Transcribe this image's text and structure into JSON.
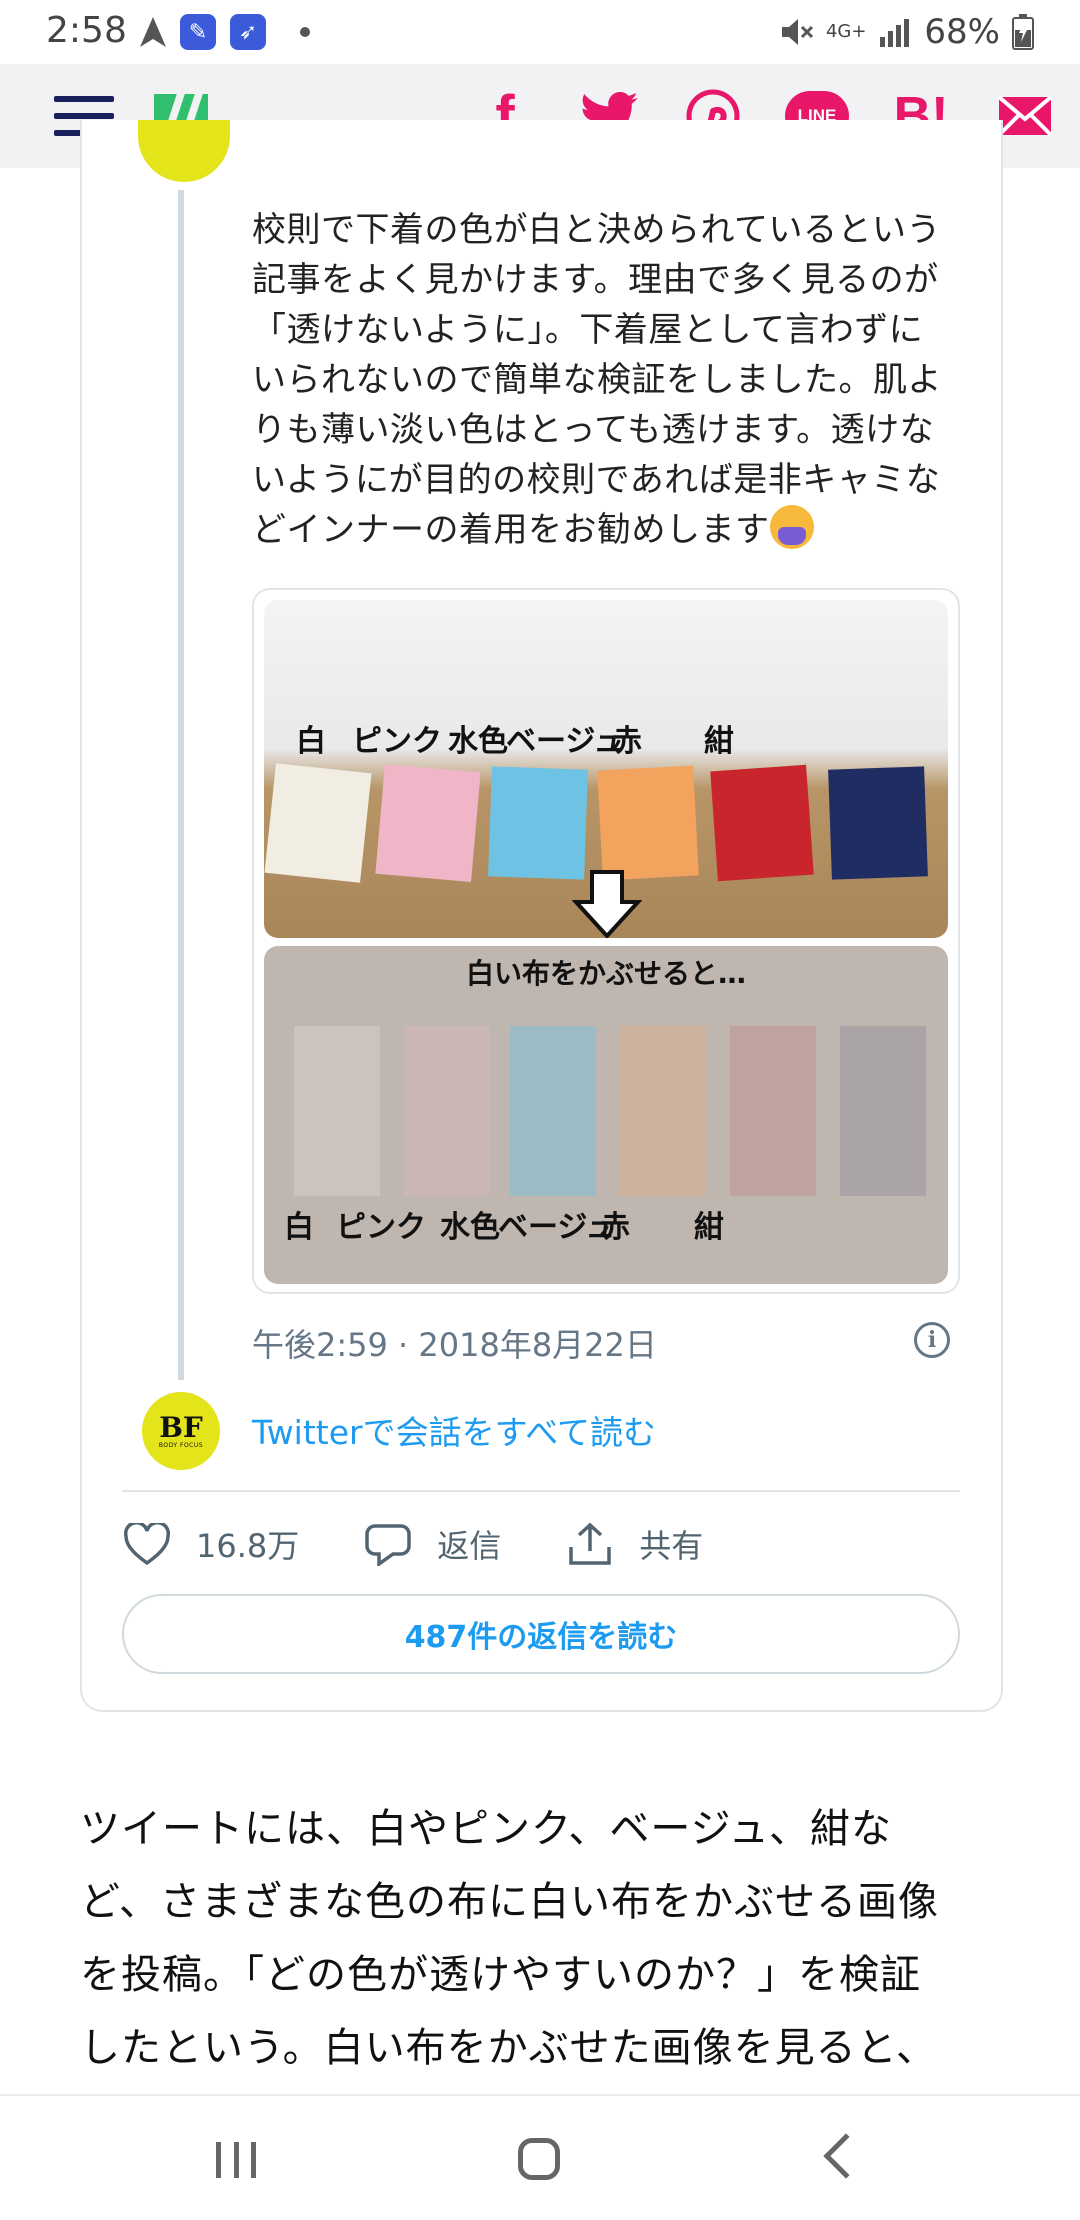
{
  "status_bar": {
    "time": "2:58",
    "network": "4G+",
    "battery": "68%"
  },
  "share_bar": {
    "icons": [
      "menu-icon",
      "site-logo",
      "facebook-icon",
      "twitter-icon",
      "pinterest-icon",
      "line-icon",
      "hatena-bookmark-icon",
      "mail-icon"
    ],
    "facebook_glyph": "f",
    "line_label": "LINE",
    "hatena_label": "B!",
    "accent_color": "#e8176a",
    "logo_color": "#2fbf6e"
  },
  "tweet": {
    "text": "校則で下着の色が白と決められているという\n記事をよく見かけます。理由で多く見るのが\n「透けないように」。下着屋として言わずに\nいられないので簡単な検証をしました。肌よ\nりも薄い淡い色はとっても透けます。透けな\nいようにが目的の校則であれば是非キャミな\nどインナーの着用をお勧めします",
    "photo": {
      "top_labels": [
        "白",
        "ピンク",
        "水色",
        "ベージュ",
        "赤",
        "紺"
      ],
      "caption": "白い布をかぶせると…",
      "bottom_labels": [
        "白",
        "ピンク",
        "水色",
        "ベージュ",
        "赤",
        "紺"
      ],
      "swatch_colors": [
        "#f1ede2",
        "#f0b6c7",
        "#6ec3e4",
        "#f2a35e",
        "#c9252c",
        "#1f2d63"
      ]
    },
    "timestamp": "午後2:59 · 2018年8月22日",
    "avatar_letters": "BF",
    "avatar_subtitle": "BODY FOCUS",
    "read_conversation": "Twitterで会話をすべて読む",
    "likes": "16.8万",
    "reply_label": "返信",
    "share_label": "共有",
    "replies_button": "487件の返信を読む",
    "link_color": "#1d9bf0"
  },
  "article": {
    "paragraph": "ツイートには、白やピンク、ベージュ、紺な\nど、さまざまな色の布に白い布をかぶせる画像\nを投稿。「どの色が透けやすいのか？」を検証\nしたという。白い布をかぶせた画像を見ると、"
  },
  "navigation": {
    "buttons": [
      "recent-apps",
      "home",
      "back"
    ]
  }
}
